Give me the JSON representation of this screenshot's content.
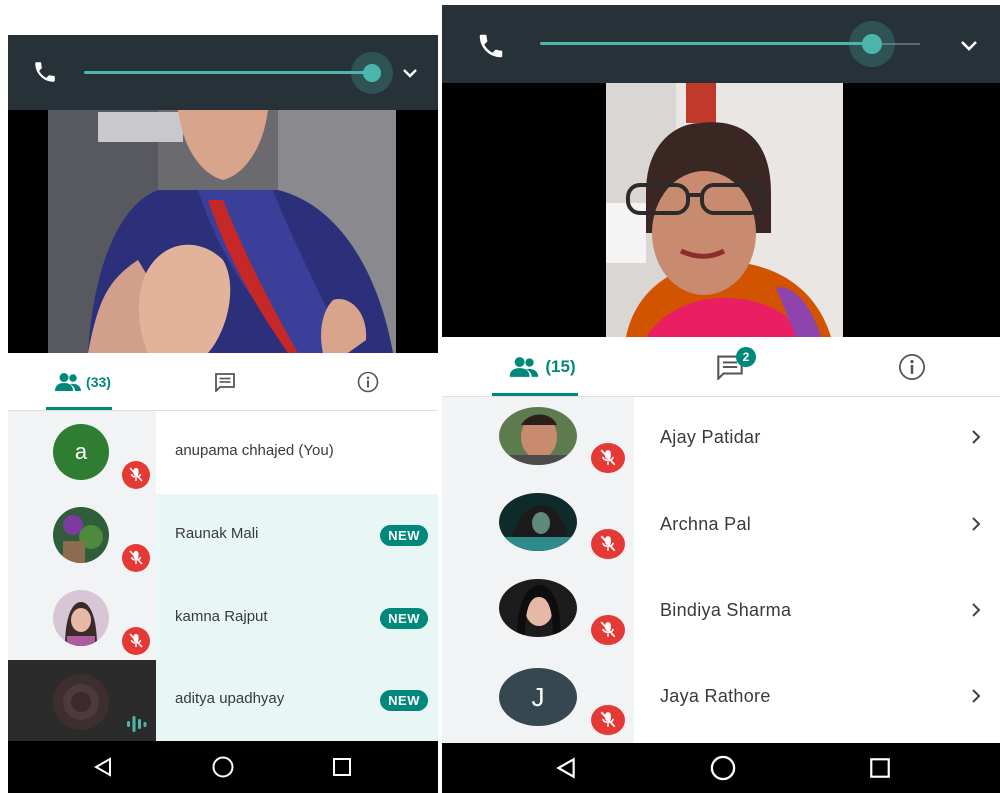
{
  "left": {
    "tabs": [
      {
        "name": "people",
        "icon": "people-icon",
        "count": "(33)",
        "active": true
      },
      {
        "name": "chat",
        "icon": "chat-icon",
        "active": false
      },
      {
        "name": "info",
        "icon": "info-icon",
        "active": false
      }
    ],
    "participants": [
      {
        "name": "anupama chhajed (You)",
        "avatar_letter": "a",
        "avatar_color": "#2e7d32",
        "muted": true,
        "is_new": false
      },
      {
        "name": "Raunak Mali",
        "avatar_letter": "",
        "muted": true,
        "is_new": true,
        "new_label": "NEW"
      },
      {
        "name": "kamna Rajput",
        "avatar_letter": "",
        "muted": true,
        "is_new": true,
        "new_label": "NEW"
      },
      {
        "name": "aditya upadhyay",
        "avatar_letter": "",
        "muted": false,
        "speaking": true,
        "is_new": true,
        "new_label": "NEW"
      }
    ]
  },
  "right": {
    "tabs": [
      {
        "name": "people",
        "icon": "people-icon",
        "count": "(15)",
        "active": true
      },
      {
        "name": "chat",
        "icon": "chat-icon",
        "badge": "2",
        "active": false
      },
      {
        "name": "info",
        "icon": "info-icon",
        "active": false
      }
    ],
    "participants": [
      {
        "name": "Ajay Patidar",
        "avatar_letter": "",
        "muted": true
      },
      {
        "name": "Archna Pal",
        "avatar_letter": "",
        "muted": true
      },
      {
        "name": "Bindiya Sharma",
        "avatar_letter": "",
        "muted": true
      },
      {
        "name": "Jaya Rathore",
        "avatar_letter": "J",
        "avatar_color": "#37474f",
        "muted": true
      }
    ]
  },
  "colors": {
    "accent": "#00897b",
    "call_bar": "#263238",
    "muted_red": "#e53935",
    "new_row_bg": "#e8f6f6"
  }
}
